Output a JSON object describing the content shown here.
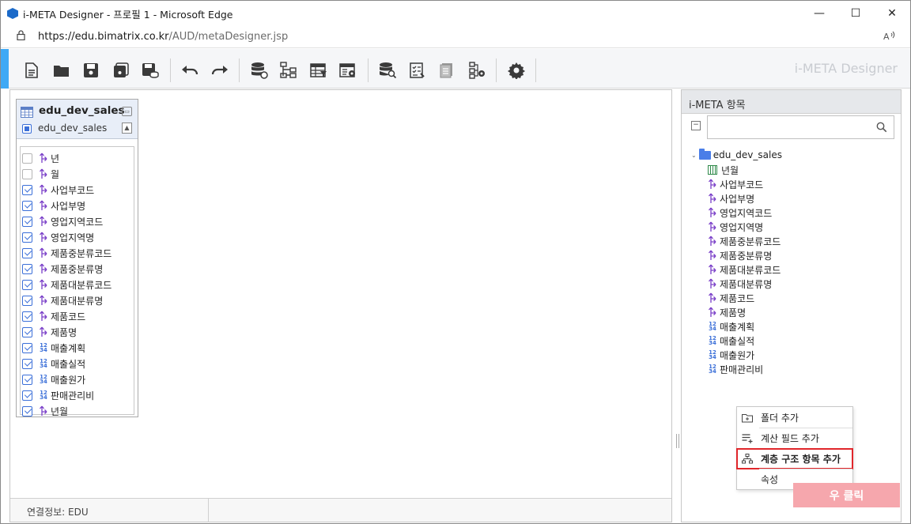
{
  "window": {
    "title": "i-META Designer - 프로필 1 - Microsoft Edge",
    "minimize": "—",
    "maximize": "☐",
    "close": "✕"
  },
  "address": {
    "host": "https://edu.bimatrix.co.kr",
    "path": "/AUD/metaDesigner.jsp"
  },
  "toolbar": {
    "brand": "i-META Designer",
    "icons": [
      "new-doc-icon",
      "open-folder-icon",
      "save-icon",
      "save-as-icon",
      "save-to-server-icon",
      "undo-icon",
      "redo-icon",
      "db-connect-icon",
      "hierarchy-icon",
      "table-filter-icon",
      "table-settings-icon",
      "db-search-icon",
      "checklist-icon",
      "document-icon",
      "tree-settings-icon",
      "gear-icon"
    ]
  },
  "table_box": {
    "name": "edu_dev_sales",
    "alias": "edu_dev_sales",
    "columns": [
      {
        "label": "년",
        "checked": false,
        "kind": "dim"
      },
      {
        "label": "월",
        "checked": false,
        "kind": "dim"
      },
      {
        "label": "사업부코드",
        "checked": true,
        "kind": "dim"
      },
      {
        "label": "사업부명",
        "checked": true,
        "kind": "dim"
      },
      {
        "label": "영업지역코드",
        "checked": true,
        "kind": "dim"
      },
      {
        "label": "영업지역명",
        "checked": true,
        "kind": "dim"
      },
      {
        "label": "제품중분류코드",
        "checked": true,
        "kind": "dim"
      },
      {
        "label": "제품중분류명",
        "checked": true,
        "kind": "dim"
      },
      {
        "label": "제품대분류코드",
        "checked": true,
        "kind": "dim"
      },
      {
        "label": "제품대분류명",
        "checked": true,
        "kind": "dim"
      },
      {
        "label": "제품코드",
        "checked": true,
        "kind": "dim"
      },
      {
        "label": "제품명",
        "checked": true,
        "kind": "dim"
      },
      {
        "label": "매출계획",
        "checked": true,
        "kind": "num"
      },
      {
        "label": "매출실적",
        "checked": true,
        "kind": "num"
      },
      {
        "label": "매출원가",
        "checked": true,
        "kind": "num"
      },
      {
        "label": "판매관리비",
        "checked": true,
        "kind": "num"
      },
      {
        "label": "년월",
        "checked": true,
        "kind": "dim"
      }
    ]
  },
  "status": {
    "connection": "연결정보: EDU"
  },
  "panel": {
    "title": "i-META 항목",
    "search_placeholder": "",
    "root": "edu_dev_sales",
    "items": [
      {
        "label": "년월",
        "kind": "cal"
      },
      {
        "label": "사업부코드",
        "kind": "dim"
      },
      {
        "label": "사업부명",
        "kind": "dim"
      },
      {
        "label": "영업지역코드",
        "kind": "dim"
      },
      {
        "label": "영업지역명",
        "kind": "dim"
      },
      {
        "label": "제품중분류코드",
        "kind": "dim"
      },
      {
        "label": "제품중분류명",
        "kind": "dim"
      },
      {
        "label": "제품대분류코드",
        "kind": "dim"
      },
      {
        "label": "제품대분류명",
        "kind": "dim"
      },
      {
        "label": "제품코드",
        "kind": "dim"
      },
      {
        "label": "제품명",
        "kind": "dim"
      },
      {
        "label": "매출계획",
        "kind": "num"
      },
      {
        "label": "매출실적",
        "kind": "num"
      },
      {
        "label": "매출원가",
        "kind": "num"
      },
      {
        "label": "판매관리비",
        "kind": "num"
      }
    ]
  },
  "context_menu": {
    "add_folder": "폴더 추가",
    "add_calc_field": "계산 필드 추가",
    "add_hierarchy": "계층 구조 항목 추가",
    "properties": "속성"
  },
  "annotation": {
    "right_click": "우 클릭"
  },
  "colors": {
    "accent": "#3fa9f5",
    "highlight": "#e0262b",
    "annotation_bg": "#f6a7ad",
    "dim_icon": "#7a3fc8",
    "num_icon": "#3b6fd8"
  }
}
